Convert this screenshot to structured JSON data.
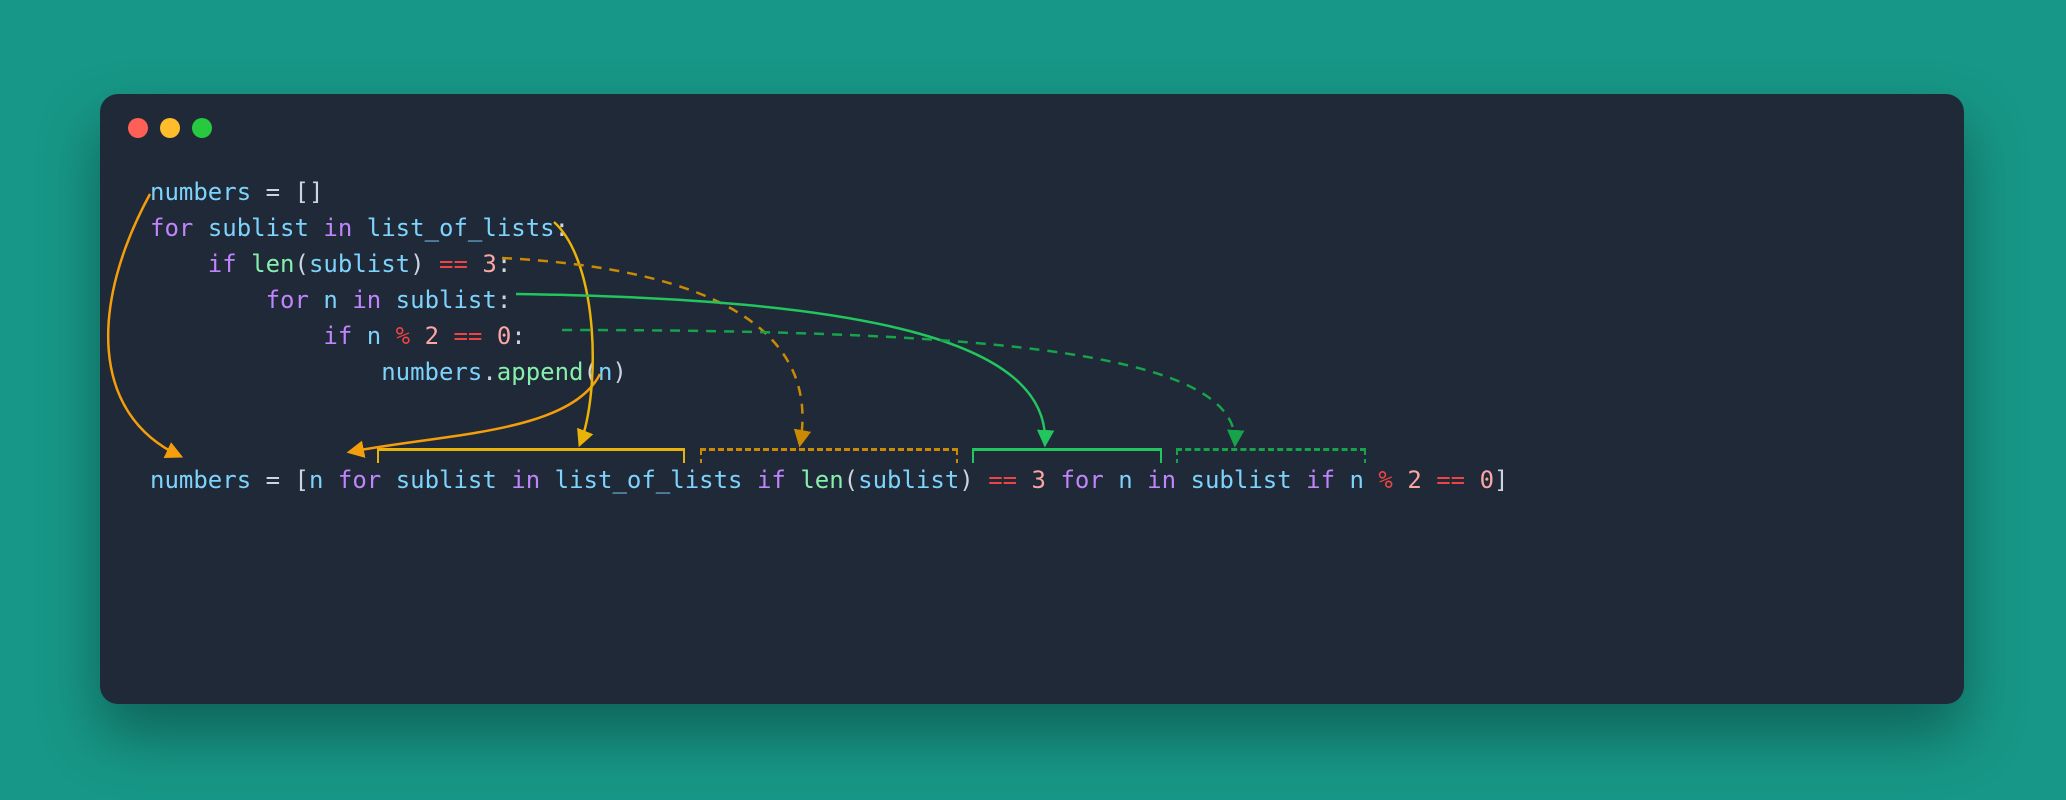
{
  "colors": {
    "bg_page": "#179787",
    "bg_frame": "#1F2937",
    "traffic_red": "#FF5F56",
    "traffic_yellow": "#FFBD2E",
    "traffic_green": "#27C93F",
    "arrow_orange": "#F59E0B",
    "arrow_yellow": "#EAB308",
    "arrow_yellow_dashed": "#CA8A04",
    "arrow_green": "#22C55E",
    "arrow_green_dashed": "#16A34A",
    "tok_var": "#7DD3FC",
    "tok_kw": "#C084FC",
    "tok_fn": "#86EFAC",
    "tok_num": "#FCA5A5",
    "tok_punc": "#CBD5E1",
    "tok_op": "#EF4444"
  },
  "code": {
    "loop": {
      "line1": {
        "numbers": "numbers",
        "eq": " = ",
        "brackets": "[]"
      },
      "line2": {
        "for_": "for",
        "sp1": " ",
        "sublist": "sublist",
        "sp2": " ",
        "in_": "in",
        "sp3": " ",
        "list_of_lists": "list_of_lists",
        "colon": ":"
      },
      "line3": {
        "indent": "    ",
        "if_": "if",
        "sp1": " ",
        "len_": "len",
        "lparen": "(",
        "sublist": "sublist",
        "rparen": ")",
        "sp2": " ",
        "eqeq": "==",
        "sp3": " ",
        "three": "3",
        "colon": ":"
      },
      "line4": {
        "indent": "        ",
        "for_": "for",
        "sp1": " ",
        "n": "n",
        "sp2": " ",
        "in_": "in",
        "sp3": " ",
        "sublist": "sublist",
        "colon": ":"
      },
      "line5": {
        "indent": "            ",
        "if_": "if",
        "sp1": " ",
        "n": "n",
        "sp2": " ",
        "pct": "%",
        "sp3": " ",
        "two": "2",
        "sp4": " ",
        "eqeq": "==",
        "sp5": " ",
        "zero": "0",
        "colon": ":"
      },
      "line6": {
        "indent": "                ",
        "numbers": "numbers",
        "dot": ".",
        "append_": "append",
        "lparen": "(",
        "n": "n",
        "rparen": ")"
      }
    },
    "comp": {
      "numbers": "numbers",
      "eq": " = ",
      "lbr": "[",
      "n1": "n",
      "sp1": " ",
      "for1": "for",
      "sp2": " ",
      "sublist1": "sublist",
      "sp3": " ",
      "in1": "in",
      "sp4": " ",
      "list_of_lists": "list_of_lists",
      "sp5": " ",
      "if1": "if",
      "sp6": " ",
      "len_": "len",
      "lp": "(",
      "sublist2": "sublist",
      "rp": ")",
      "sp7": " ",
      "eqeq1": "==",
      "sp8": " ",
      "three": "3",
      "sp9": " ",
      "for2": "for",
      "sp10": " ",
      "n2": "n",
      "sp11": " ",
      "in2": "in",
      "sp12": " ",
      "sublist3": "sublist",
      "sp13": " ",
      "if2": "if",
      "sp14": " ",
      "n3": "n",
      "sp15": " ",
      "pct": "%",
      "sp16": " ",
      "two": "2",
      "sp17": " ",
      "eqeq2": "==",
      "sp18": " ",
      "zero": "0",
      "rbr": "]"
    }
  },
  "diagram": {
    "arrows": [
      {
        "name": "arrow-numbers-init",
        "from": "loop line 1 (numbers = [])",
        "to": "comprehension numbers/[ n",
        "color": "orange",
        "style": "solid"
      },
      {
        "name": "arrow-for-sublist",
        "from": "loop line 2 (for sublist in list_of_lists)",
        "to": "for sublist in list_of_lists",
        "color": "yellow",
        "style": "solid"
      },
      {
        "name": "arrow-if-len",
        "from": "loop line 3 (if len(sublist) == 3)",
        "to": "if len(sublist) == 3",
        "color": "yellow-dashed",
        "style": "dashed"
      },
      {
        "name": "arrow-for-n",
        "from": "loop line 4 (for n in sublist)",
        "to": "for n in sublist",
        "color": "green",
        "style": "solid"
      },
      {
        "name": "arrow-if-mod",
        "from": "loop line 5 (if n % 2 == 0)",
        "to": "if n % 2 == 0",
        "color": "green-dashed",
        "style": "dashed"
      },
      {
        "name": "arrow-append",
        "from": "loop line 6 (numbers.append(n))",
        "to": "[n",
        "color": "orange",
        "style": "solid"
      }
    ]
  }
}
